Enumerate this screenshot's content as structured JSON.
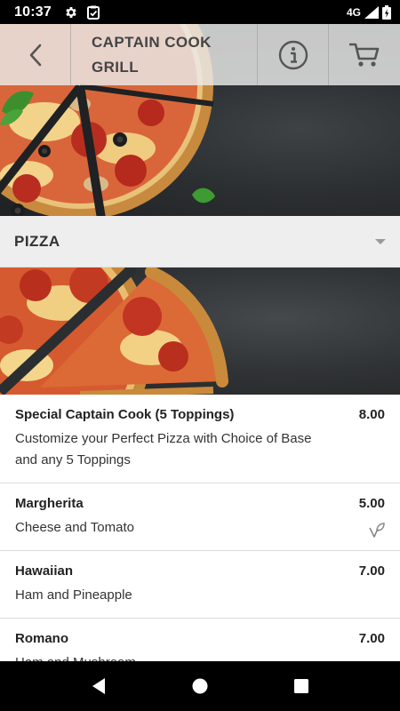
{
  "status": {
    "time": "10:37",
    "network": "4G"
  },
  "header": {
    "title": "CAPTAIN COOK GRILL"
  },
  "category": {
    "label": "PIZZA"
  },
  "menu": {
    "items": [
      {
        "name": "Special Captain Cook (5 Toppings)",
        "price": "8.00",
        "description": "Customize your Perfect Pizza with Choice of Base and any 5 Toppings",
        "vegetarian": false
      },
      {
        "name": "Margherita",
        "price": "5.00",
        "description": "Cheese and Tomato",
        "vegetarian": true
      },
      {
        "name": "Hawaiian",
        "price": "7.00",
        "description": "Ham and Pineapple",
        "vegetarian": false
      },
      {
        "name": "Romano",
        "price": "7.00",
        "description": "Ham and Mushroom",
        "vegetarian": false
      }
    ]
  },
  "icons": {
    "back": "chevron-left-icon",
    "info": "info-icon",
    "cart": "cart-icon",
    "veg": "vegetarian-icon"
  },
  "colors": {
    "header_bg": "#ebebeb",
    "category_bg": "#eeeeee",
    "text": "#222222"
  }
}
